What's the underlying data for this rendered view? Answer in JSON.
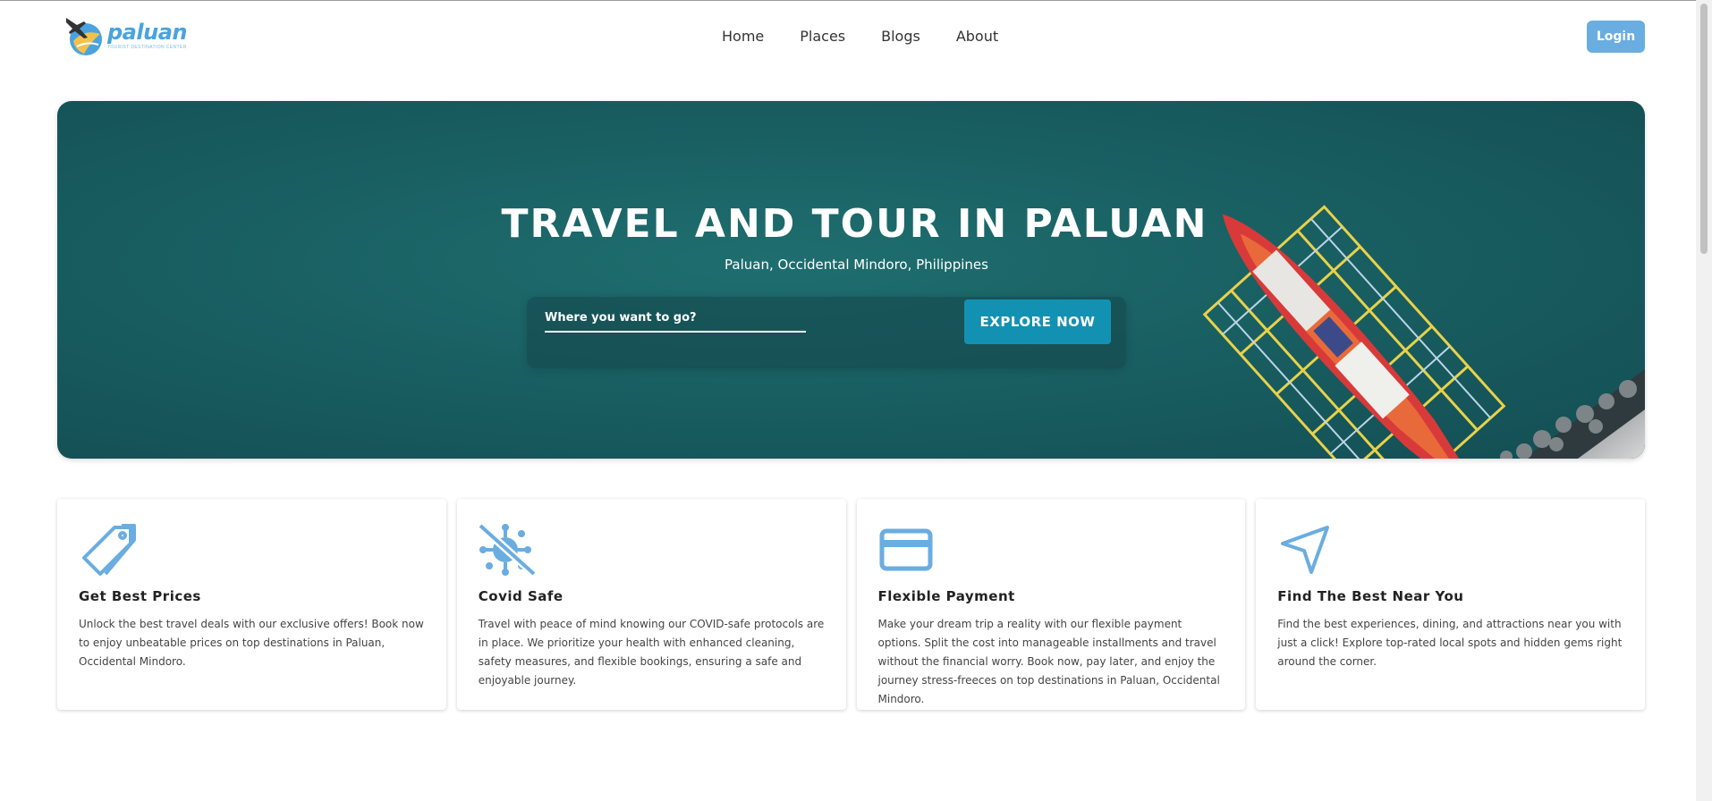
{
  "header": {
    "logo_text": "paluan",
    "logo_tagline": "TOURIST DESTINATION CENTER",
    "nav": [
      "Home",
      "Places",
      "Blogs",
      "About"
    ],
    "login_label": "Login"
  },
  "hero": {
    "title": "TRAVEL AND TOUR IN PALUAN",
    "subtitle": "Paluan, Occidental Mindoro, Philippines",
    "search_placeholder": "Where you want to go?",
    "explore_label": "EXPLORE NOW"
  },
  "features": [
    {
      "icon": "price-tag-icon",
      "title": "Get Best Prices",
      "text": "Unlock the best travel deals with our exclusive offers! Book now to enjoy unbeatable prices on top destinations in Paluan, Occidental Mindoro."
    },
    {
      "icon": "no-virus-icon",
      "title": "Covid Safe",
      "text": "Travel with peace of mind knowing our COVID-safe protocols are in place. We prioritize your health with enhanced cleaning, safety measures, and flexible bookings, ensuring a safe and enjoyable journey."
    },
    {
      "icon": "credit-card-icon",
      "title": "Flexible Payment",
      "text": "Make your dream trip a reality with our flexible payment options. Split the cost into manageable installments and travel without the financial worry. Book now, pay later, and enjoy the journey stress-freeces on top destinations in Paluan, Occidental Mindoro."
    },
    {
      "icon": "navigation-arrow-icon",
      "title": "Find The Best Near You",
      "text": "Find the best experiences, dining, and attractions near you with just a click! Explore top-rated local spots and hidden gems right around the corner."
    }
  ],
  "colors": {
    "accent": "#6aade0",
    "button": "#1391b3",
    "hero_sea": "#195f62",
    "icon": "#6aade0"
  }
}
